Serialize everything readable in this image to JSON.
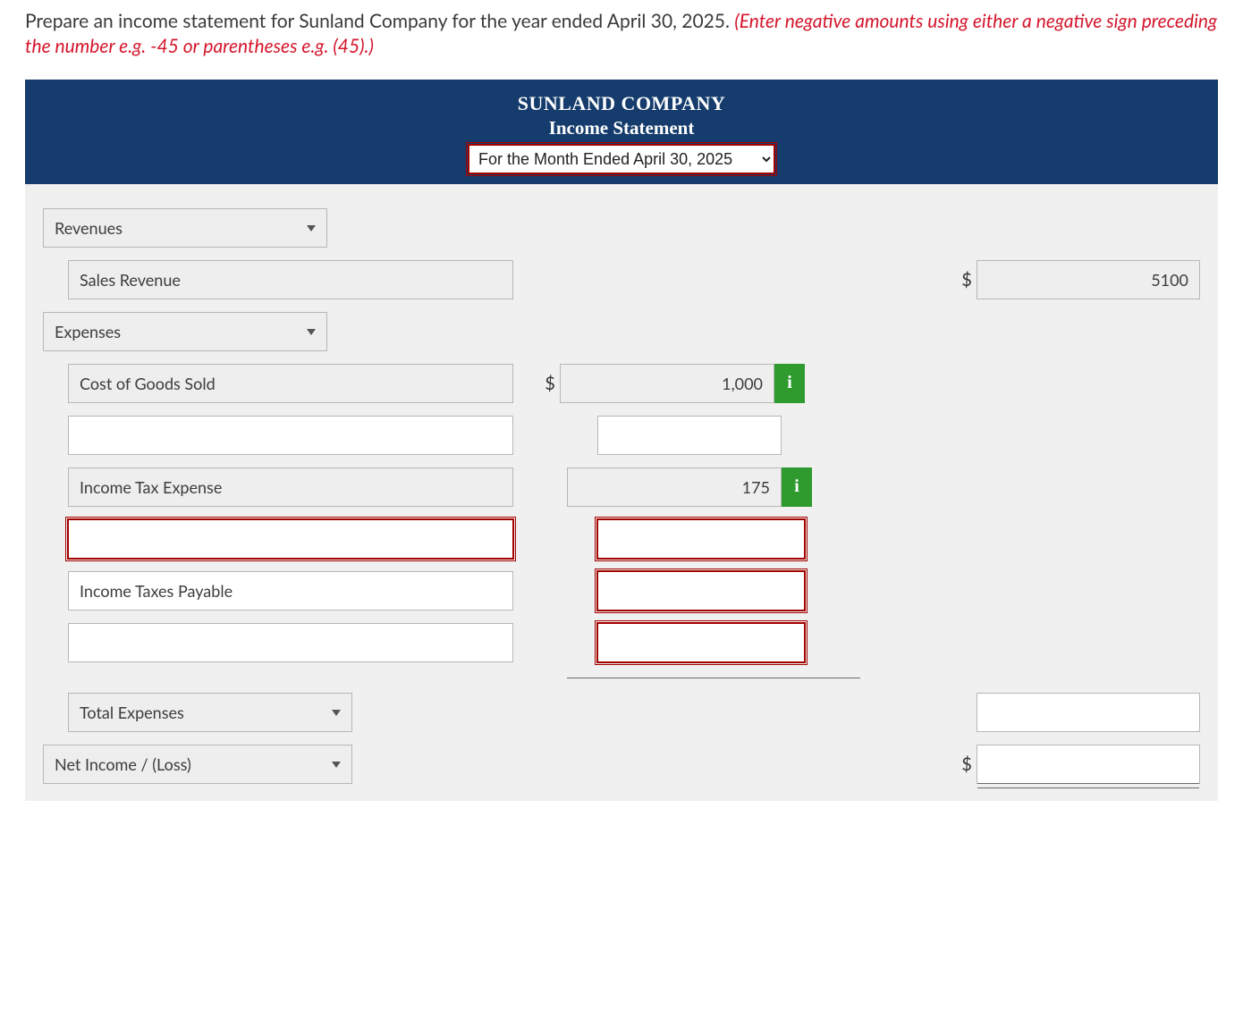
{
  "instructions": {
    "main": "Prepare an income statement for Sunland Company for the year ended April 30, 2025. ",
    "note": "(Enter negative amounts using either a negative sign preceding the number e.g. -45 or parentheses e.g. (45).)"
  },
  "header": {
    "company": "SUNLAND COMPANY",
    "title": "Income Statement",
    "period_selected": "For the Month Ended April 30, 2025"
  },
  "sections": {
    "revenues_label": "Revenues",
    "sales_revenue_label": "Sales Revenue",
    "sales_revenue_amount": "5100",
    "expenses_label": "Expenses",
    "cogs_label": "Cost of Goods Sold",
    "cogs_amount": "1,000",
    "blank1_label": "",
    "blank1_amount": "",
    "income_tax_exp_label": "Income Tax Expense",
    "income_tax_exp_amount": "175",
    "error_label": "",
    "error_amount": "",
    "income_taxes_payable_label": "Income Taxes Payable",
    "income_taxes_payable_amount": "",
    "blank2_label": "",
    "blank2_amount": "",
    "total_expenses_label": "Total Expenses",
    "total_expenses_amount": "",
    "net_income_label": "Net Income / (Loss)",
    "net_income_amount": ""
  },
  "symbols": {
    "dollar": "$",
    "info": "i"
  }
}
